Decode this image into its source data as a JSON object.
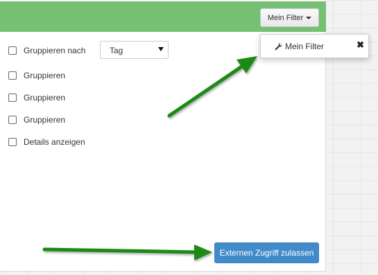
{
  "header": {
    "filter_button_label": "Mein Filter"
  },
  "dropdown": {
    "item_label": "Mein Filter",
    "close_glyph": "✖"
  },
  "options": {
    "group_by_label": "Gruppieren nach",
    "group_by_value": "Tag",
    "group_1_label": "Gruppieren",
    "group_2_label": "Gruppieren",
    "group_3_label": "Gruppieren",
    "details_label": "Details anzeigen"
  },
  "actions": {
    "external_access_label": "Externen Zugriff zulassen"
  },
  "colors": {
    "header_green": "#75c073",
    "button_blue": "#428bca",
    "arrow_green": "#1e8a16"
  },
  "icons": {
    "dropdown_item": "wrench-icon",
    "dropdown_close": "close-icon",
    "annotations": "arrow-icon"
  }
}
